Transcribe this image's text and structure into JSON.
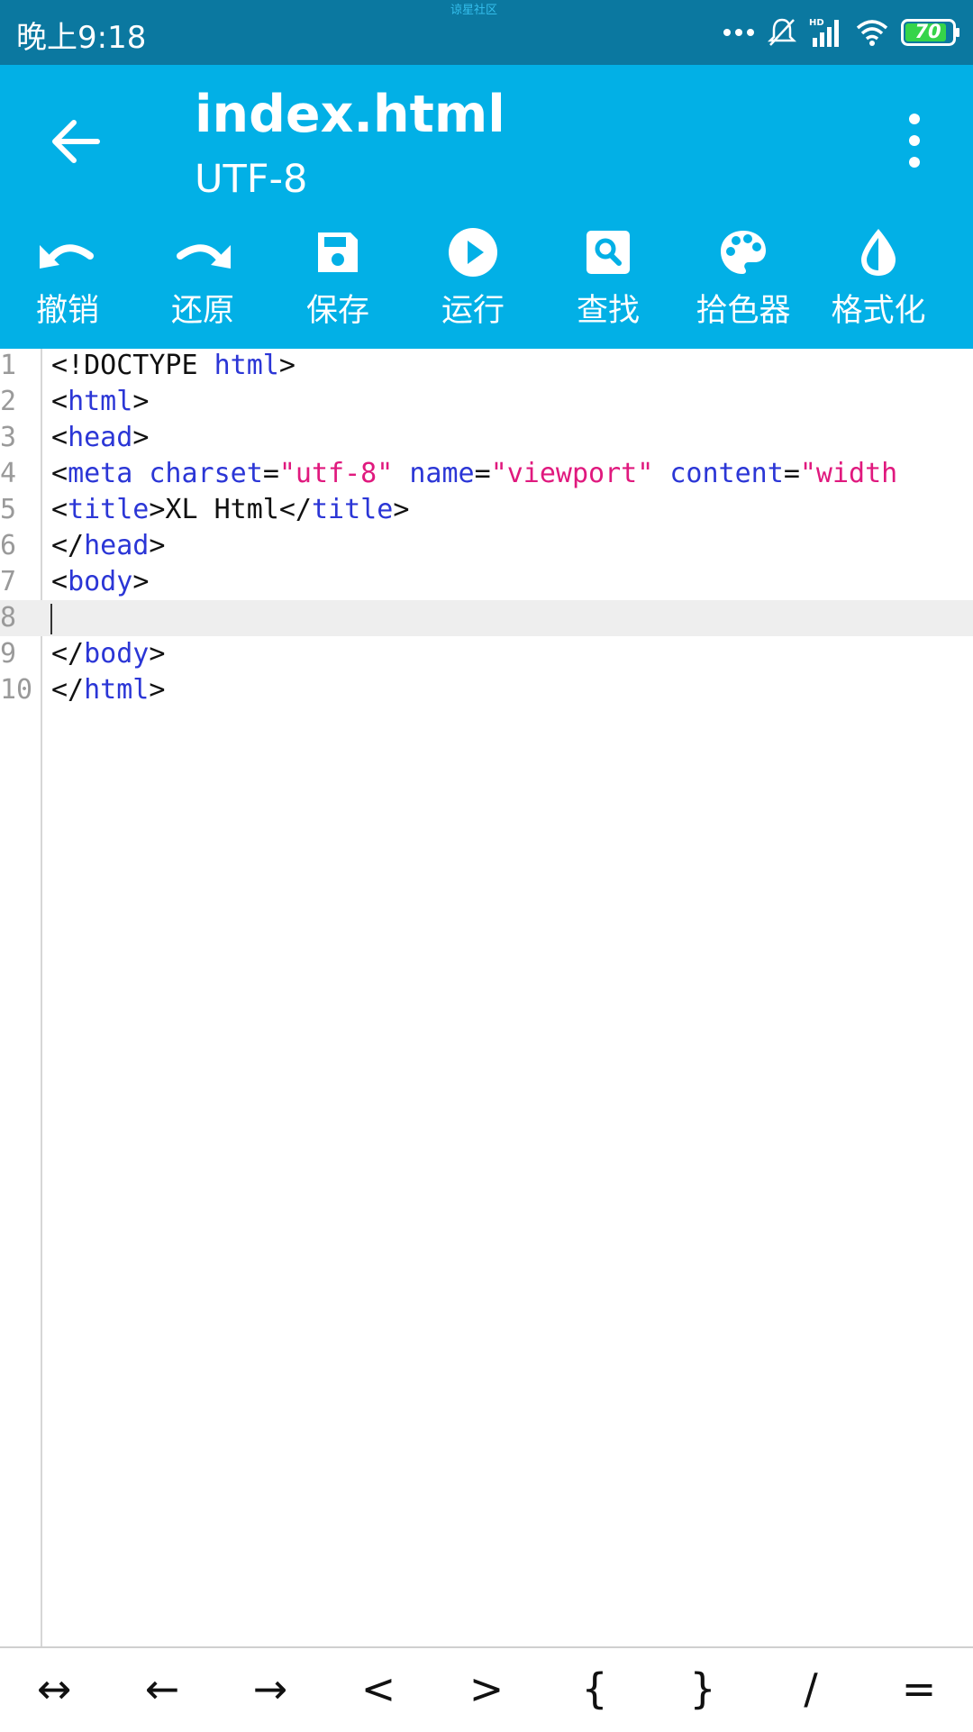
{
  "status_bar": {
    "time": "晚上9:18",
    "watermark": "谅星社区",
    "battery": "70"
  },
  "app_bar": {
    "title": "index.html",
    "subtitle": "UTF-8"
  },
  "toolbar": [
    {
      "label": "撤销",
      "icon": "undo-icon"
    },
    {
      "label": "还原",
      "icon": "redo-icon"
    },
    {
      "label": "保存",
      "icon": "save-icon"
    },
    {
      "label": "运行",
      "icon": "play-icon"
    },
    {
      "label": "查找",
      "icon": "search-icon"
    },
    {
      "label": "拾色器",
      "icon": "palette-icon"
    },
    {
      "label": "格式化",
      "icon": "format-drop-icon"
    }
  ],
  "editor": {
    "current_line": 8,
    "line_numbers": [
      "1",
      "2",
      "3",
      "4",
      "5",
      "6",
      "7",
      "8",
      "9",
      "10"
    ],
    "lines": [
      "<!DOCTYPE html>",
      "<html>",
      "<head>",
      "<meta charset=\"utf-8\" name=\"viewport\" content=\"width",
      "<title>XL Html</title>",
      "</head>",
      "<body>",
      "",
      "</body>",
      "</html>"
    ]
  },
  "symbols": [
    "↔",
    "←",
    "→",
    "<",
    ">",
    "{",
    "}",
    "/",
    "="
  ],
  "colors": {
    "status_bar": "#0b78a0",
    "app_bar": "#02b0e6",
    "tag": "#2b36d6",
    "string": "#e0197e"
  }
}
